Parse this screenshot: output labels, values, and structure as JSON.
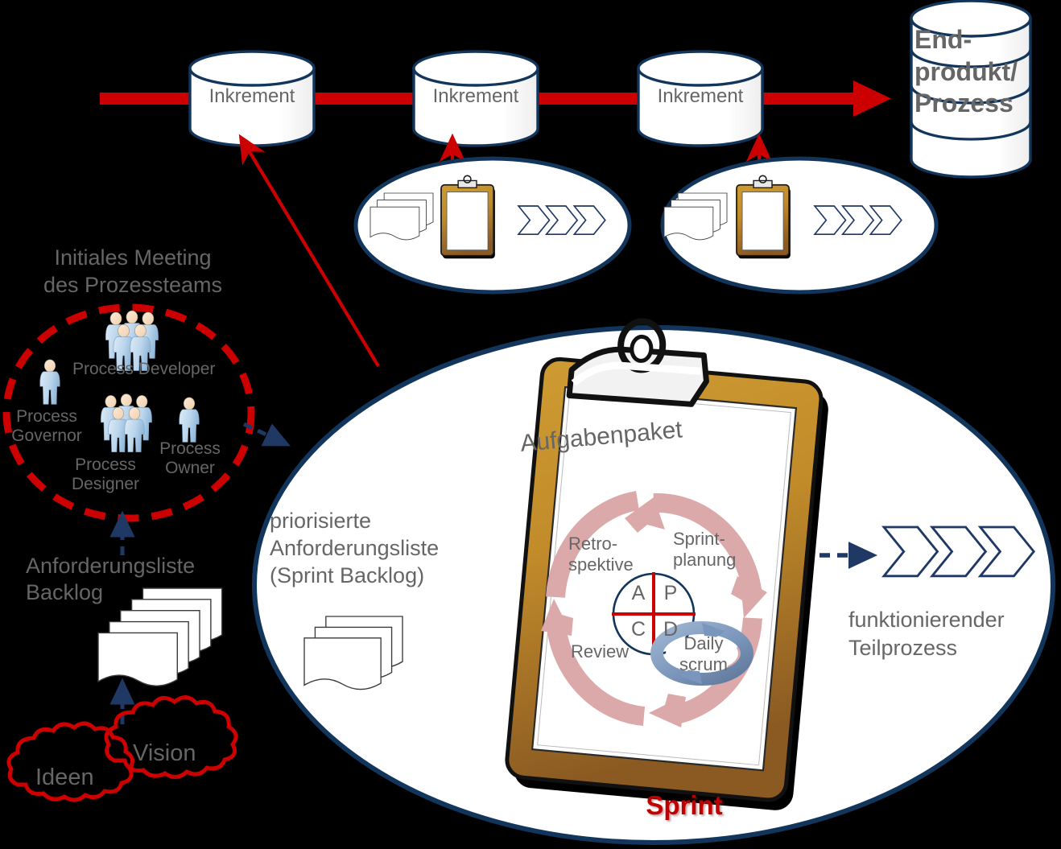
{
  "meta": {
    "title": "Agiles Prozessmanagement - Scrum Vorgehensmodell",
    "background": "#000000",
    "label_color": "#666666"
  },
  "colors": {
    "red": "#CC0000",
    "dark_red": "#C00000",
    "navy": "#12355B",
    "navy_dark": "#1F3864",
    "clipboard_gold": "#C8932B",
    "clipboard_brown": "#8B5A22",
    "pink_arrow": "#DBA9A9",
    "steel_blue": "#7B96BC",
    "person_blue": "#BBD5EA",
    "person_skin": "#F6DCC3",
    "white": "#FFFFFF"
  },
  "timeline": {
    "arrow_color": "#CC0000",
    "increments": [
      {
        "label": "Inkrement"
      },
      {
        "label": "Inkrement"
      },
      {
        "label": "Inkrement"
      }
    ],
    "endproduct": {
      "line1": "End-",
      "line2": "produkt/",
      "line3": "Prozess",
      "shape": "stacked-cylinder"
    }
  },
  "team_circle": {
    "title_line1": "Initiales Meeting",
    "title_line2": "des Prozessteams",
    "border_style": "dashed",
    "border_color": "#CC0000",
    "roles": [
      {
        "name": "Process Developer",
        "icon": "group-of-people-icon",
        "count": 5
      },
      {
        "name": "Process\nGovernor",
        "icon": "single-person-icon",
        "count": 1
      },
      {
        "name": "Process\nDesigner",
        "icon": "group-of-people-icon",
        "count": 5
      },
      {
        "name": "Process\nOwner",
        "icon": "single-person-icon",
        "count": 1
      }
    ]
  },
  "backlog": {
    "title_line1": "Anforderungsliste",
    "title_line2": "Backlog",
    "icon": "document-stack-icon"
  },
  "ideas": {
    "cloud_left": "Ideen",
    "cloud_right": "Vision",
    "cloud_color": "#CC0000"
  },
  "sprint_ellipses": [
    {
      "icons": [
        "document-stack-icon",
        "clipboard-icon",
        "chevron-process-icon"
      ]
    },
    {
      "icons": [
        "document-stack-icon",
        "clipboard-icon",
        "chevron-process-icon"
      ]
    }
  ],
  "main_sprint": {
    "label": "Sprint",
    "label_color": "#C00000",
    "sprint_backlog": {
      "line1": "priorisierte",
      "line2": "Anforderungsliste",
      "line3": "(Sprint Backlog)",
      "icon": "document-stack-icon"
    },
    "clipboard": {
      "heading": "Aufgabenpaket",
      "icon": "clipboard-icon"
    },
    "cycle": {
      "steps": [
        {
          "id": "sprint-planung",
          "line1": "Sprint-",
          "line2": "planung"
        },
        {
          "id": "daily-scrum",
          "line1": "Daily",
          "line2": "scrum"
        },
        {
          "id": "review",
          "line1": "Review",
          "line2": ""
        },
        {
          "id": "retrospektive",
          "line1": "Retro-",
          "line2": "spektive"
        }
      ],
      "arrow_color": "#DBA9A9",
      "daily_scrum_color": "#7B96BC"
    },
    "pdca": {
      "quadrants": [
        {
          "pos": "top-left",
          "letter": "A"
        },
        {
          "pos": "top-right",
          "letter": "P"
        },
        {
          "pos": "bottom-left",
          "letter": "C"
        },
        {
          "pos": "bottom-right",
          "letter": "D"
        }
      ],
      "cross_color": "#CC0000",
      "circle_color": "#12355B"
    },
    "output": {
      "line1": "funktionierender",
      "line2": "Teilprozess",
      "icon": "chevron-process-icon"
    }
  }
}
